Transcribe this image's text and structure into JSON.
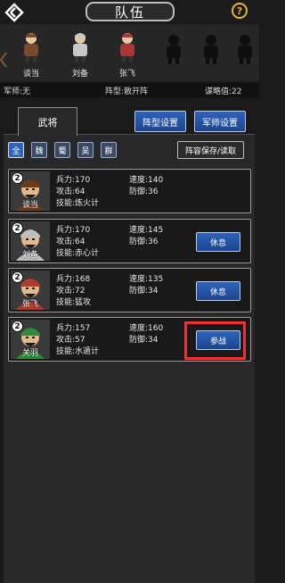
{
  "header": {
    "title": "队伍"
  },
  "party": [
    {
      "name": "谈当",
      "color": "#7a4a2a"
    },
    {
      "name": "刘备",
      "color": "#c8c8c8"
    },
    {
      "name": "张飞",
      "color": "#a83838"
    }
  ],
  "info": {
    "advisor": "军师:无",
    "formation": "阵型:散开阵",
    "strategy": "谋略值:22"
  },
  "tabs": {
    "general": "武将"
  },
  "actions": {
    "formation_settings": "阵型设置",
    "advisor_settings": "军师设置",
    "save_load": "阵容保存/读取"
  },
  "filters": [
    "全",
    "魏",
    "蜀",
    "吴",
    "群"
  ],
  "generals": [
    {
      "level": "2",
      "name": "谈当",
      "troops": "兵力:170",
      "speed": "速度:140",
      "attack": "攻击:64",
      "defense": "防御:36",
      "skill": "技能:炼火计",
      "button": "",
      "accent": "#6b3b1e"
    },
    {
      "level": "2",
      "name": "刘备",
      "troops": "兵力:170",
      "speed": "速度:145",
      "attack": "攻击:64",
      "defense": "防御:36",
      "skill": "技能:赤心计",
      "button": "休息",
      "accent": "#bfbfbf"
    },
    {
      "level": "2",
      "name": "张飞",
      "troops": "兵力:168",
      "speed": "速度:135",
      "attack": "攻击:72",
      "defense": "防御:34",
      "skill": "技能:猛攻",
      "button": "休息",
      "accent": "#b03a2e"
    },
    {
      "level": "2",
      "name": "关羽",
      "troops": "兵力:157",
      "speed": "速度:160",
      "attack": "攻击:57",
      "defense": "防御:34",
      "skill": "技能:水遁计",
      "button": "参战",
      "accent": "#2f8a3a"
    }
  ],
  "colors": {
    "accent_blue": "#2e63b8",
    "highlight_red": "#e53535",
    "help_gold": "#e0b830"
  }
}
